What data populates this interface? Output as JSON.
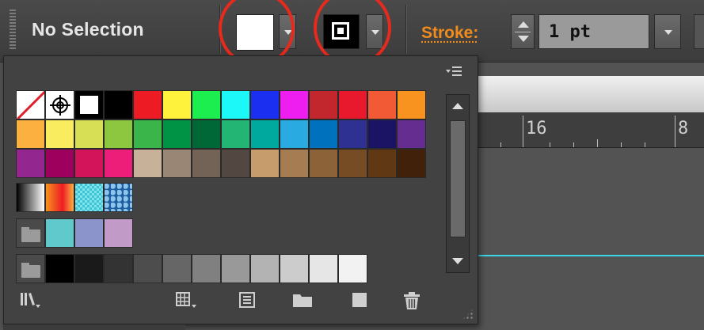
{
  "control_bar": {
    "selection_label": "No Selection",
    "fill_icon": "fill-swatch-icon",
    "stroke_icon": "stroke-swatch-icon",
    "stroke_label": "Stroke:",
    "stroke_weight": "1 pt",
    "highlight_color": "#e62a1e"
  },
  "ruler": {
    "numbers": [
      "16",
      "8"
    ]
  },
  "swatches_panel": {
    "menu_icon": "panel-menu-icon",
    "rows": [
      [
        "none",
        "registration",
        "white",
        "#000000",
        "#ed1c24",
        "#fff23d",
        "#1cee4f",
        "#1cf7f7",
        "#1a2ff0",
        "#ee1df0",
        "#c1272d",
        "#e8192c",
        "#f15a35",
        "#f7931e"
      ],
      [
        "#fbb040",
        "#f9ed5f",
        "#d7df54",
        "#8dc63f",
        "#39b54a",
        "#009245",
        "#006837",
        "#22b573",
        "#00a99d",
        "#29abe2",
        "#0071bc",
        "#2e3192",
        "#1b1464",
        "#662d91"
      ],
      [
        "#93278f",
        "#9e005d",
        "#d4145a",
        "#ed1e79",
        "#c7b299",
        "#998675",
        "#736357",
        "#534741",
        "#c69c6d",
        "#a67c52",
        "#8c6239",
        "#754c24",
        "#603813",
        "#42210b"
      ],
      [
        "grad-bw",
        "grad-orange",
        "pattern-cyan",
        "pattern-blue"
      ],
      [
        "folder",
        "#5fc9cc",
        "#8c94cc",
        "#c29ac7"
      ],
      [
        "folder",
        "#000000",
        "#1a1a1a",
        "#333333",
        "#4d4d4d",
        "#666666",
        "#808080",
        "#999999",
        "#b3b3b3",
        "#cccccc",
        "#e6e6e6",
        "#f2f2f2"
      ]
    ],
    "bottom_icons": [
      "swatch-libraries-icon",
      "show-swatch-kinds-icon",
      "swatch-options-icon",
      "new-color-group-icon",
      "new-swatch-icon",
      "delete-swatch-icon"
    ]
  }
}
